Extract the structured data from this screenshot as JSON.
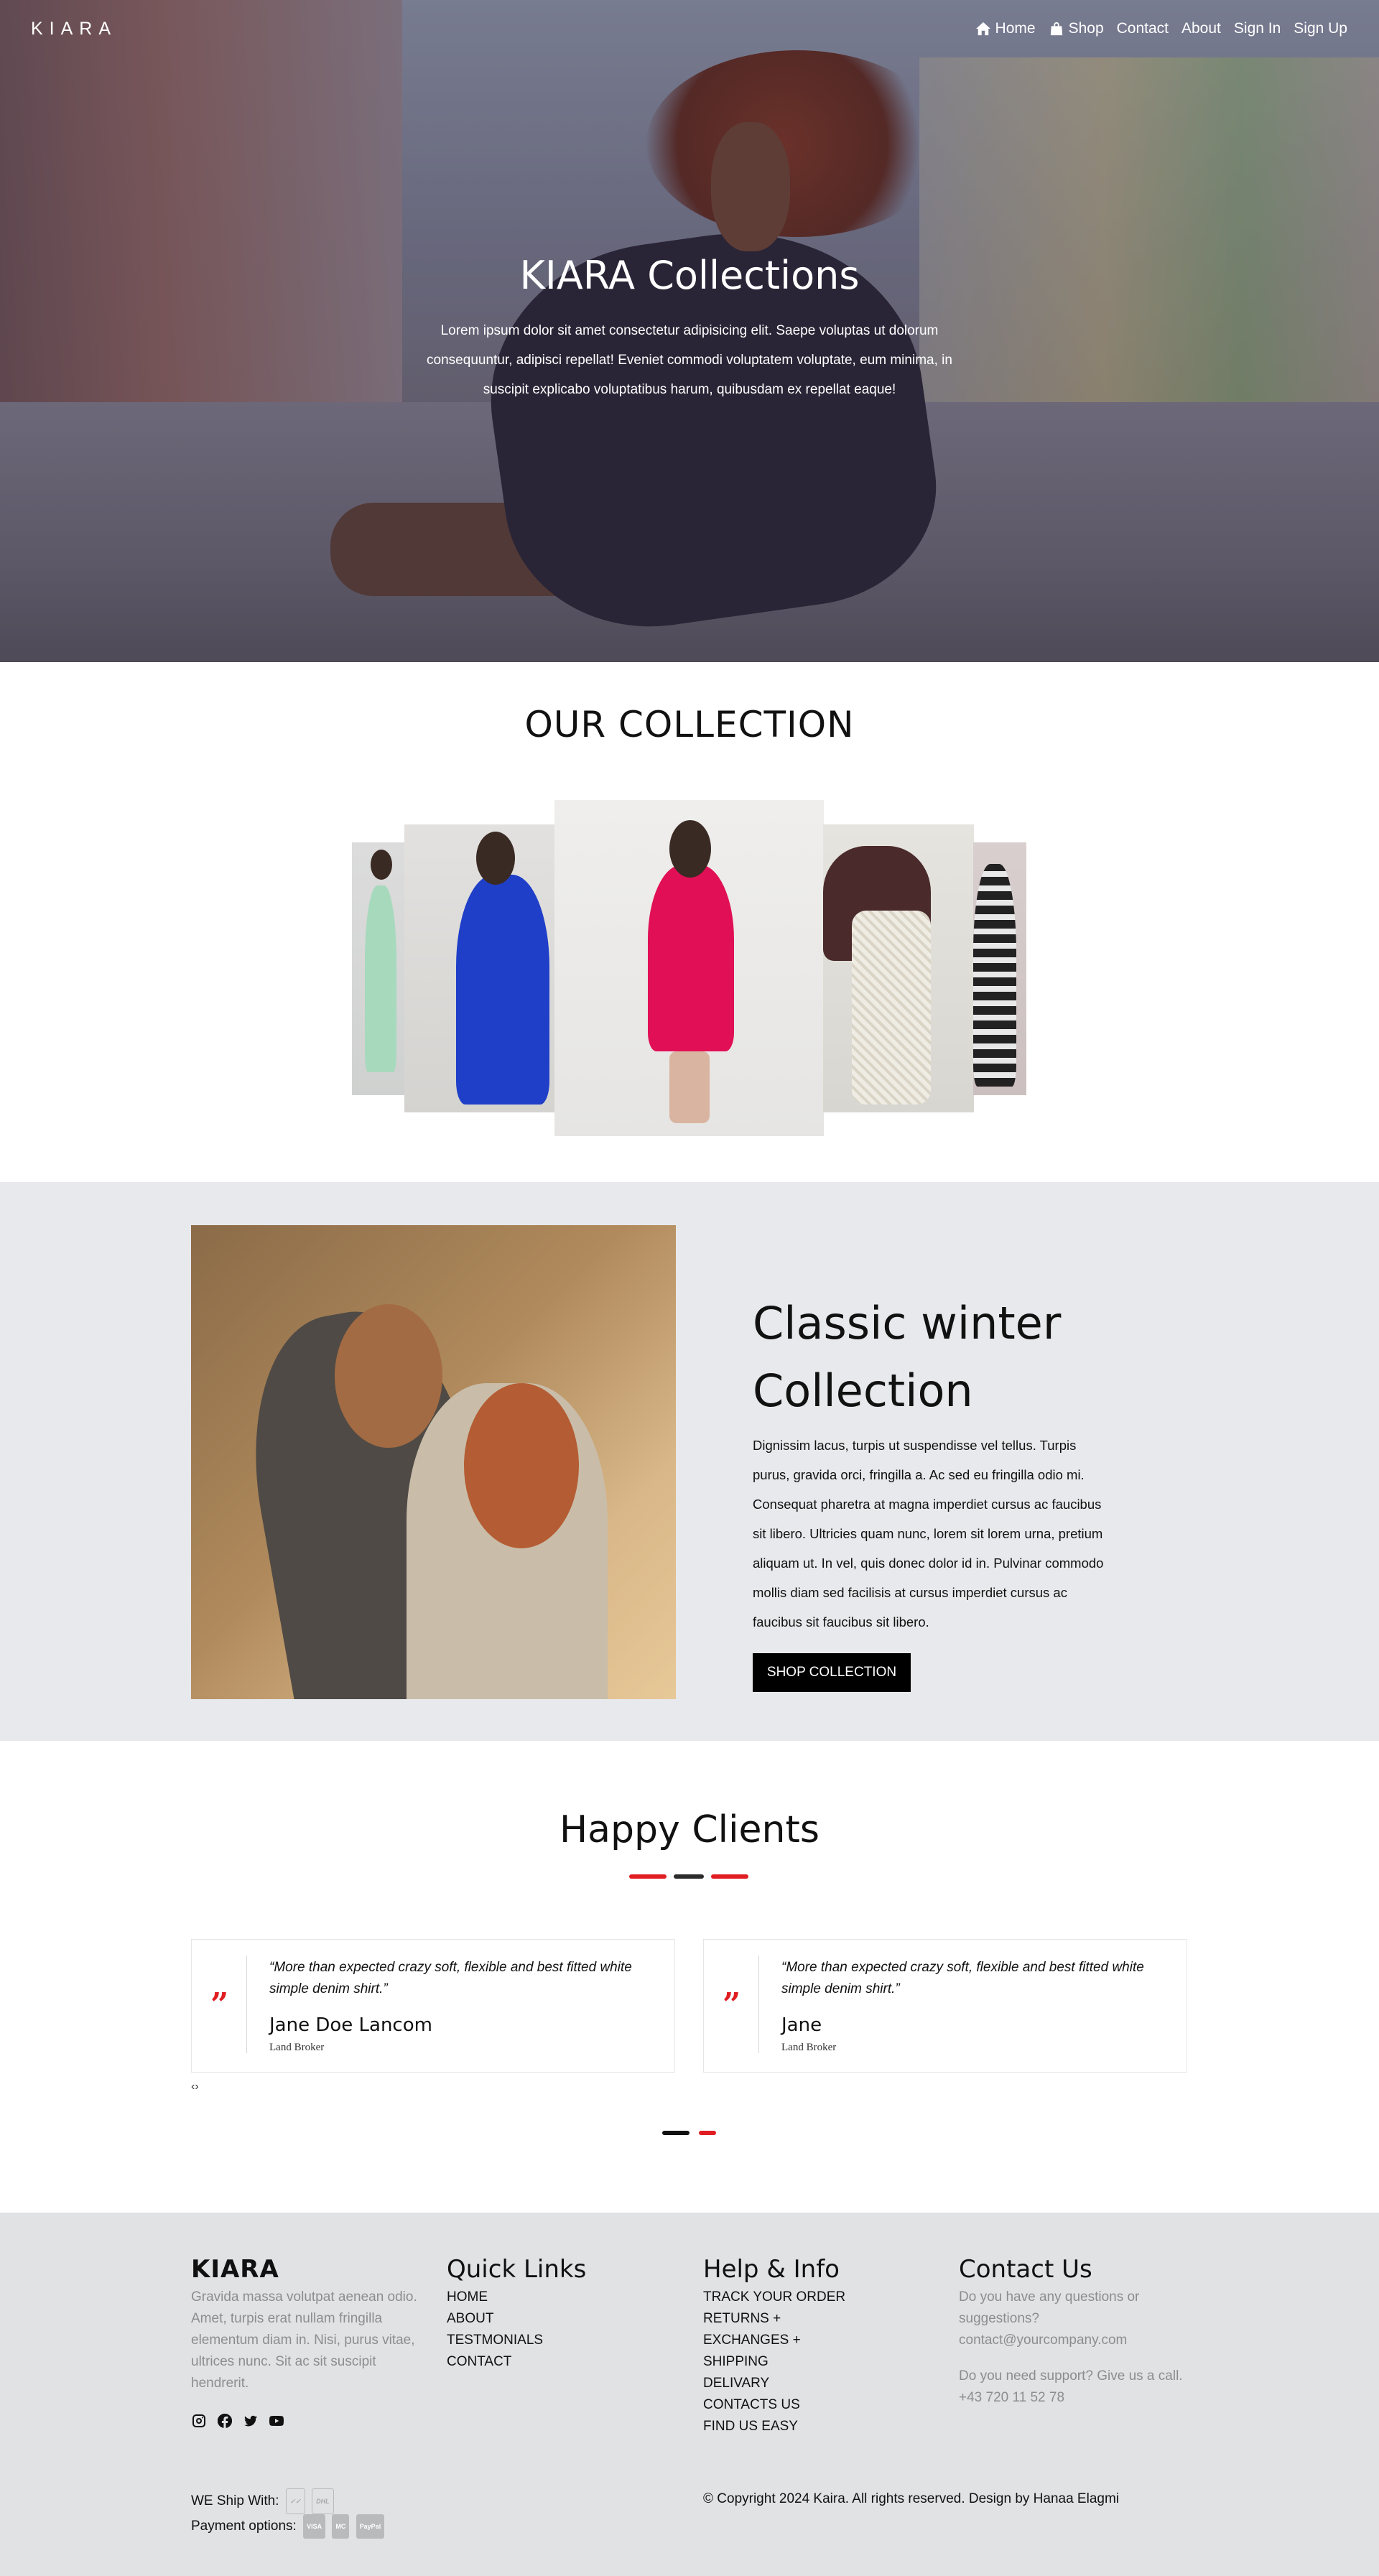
{
  "nav": {
    "logo": "KIARA",
    "links": [
      "Home",
      "Shop",
      "Contact",
      "About",
      "Sign In",
      "Sign Up"
    ]
  },
  "hero": {
    "title": "KIARA Collections",
    "text": "Lorem ipsum dolor sit amet consectetur adipisicing elit. Saepe voluptas ut dolorum consequuntur, adipisci repellat! Eveniet commodi voluptatem voluptate, eum minima, in suscipit explicabo voluptatibus harum, quibusdam ex repellat eaque!"
  },
  "collection": {
    "title": "OUR COLLECTION",
    "cards": [
      {
        "dress_color": "#a7d9bd"
      },
      {
        "dress_color": "#1f3fc8"
      },
      {
        "dress_color": "#e10f55"
      },
      {
        "dress_color": "#4a2a2a"
      },
      {
        "dress_color": "#2b2b2b"
      }
    ]
  },
  "winter": {
    "title": "Classic winter Collection",
    "text": "Dignissim lacus, turpis ut suspendisse vel tellus. Turpis purus, gravida orci, fringilla a. Ac sed eu fringilla odio mi. Consequat pharetra at magna imperdiet cursus ac faucibus sit libero. Ultricies quam nunc, lorem sit lorem urna, pretium aliquam ut. In vel, quis donec dolor id in. Pulvinar commodo mollis diam sed facilisis at cursus imperdiet cursus ac faucibus sit faucibus sit libero.",
    "button": "SHOP COLLECTION"
  },
  "clients": {
    "title": "Happy Clients",
    "testimonials": [
      {
        "quote": "“More than expected crazy soft, flexible and best fitted white simple denim shirt.”",
        "name": "Jane Doe Lancom",
        "role": "Land Broker"
      },
      {
        "quote": "“More than expected crazy soft, flexible and best fitted white simple denim shirt.”",
        "name": "Jane",
        "role": "Land Broker"
      }
    ],
    "arrows": "‹›"
  },
  "footer": {
    "brand": "KIARA",
    "about": "Gravida massa volutpat aenean odio. Amet, turpis erat nullam fringilla elementum diam in. Nisi, purus vitae, ultrices nunc. Sit ac sit suscipit hendrerit.",
    "quick_links": {
      "heading": "Quick Links",
      "items": [
        "HOME",
        "ABOUT",
        "TESTMONIALS",
        "CONTACT"
      ]
    },
    "help": {
      "heading": "Help & Info",
      "items": [
        "TRACK YOUR ORDER",
        "RETURNS +",
        "EXCHANGES +",
        "SHIPPING",
        "DELIVARY",
        "CONTACTS US",
        "FIND US EASY"
      ]
    },
    "contact": {
      "heading": "Contact Us",
      "line1": "Do you have any questions or suggestions?",
      "email": "contact@yourcompany.com",
      "line2": "Do you need support? Give us a call.",
      "phone": "+43 720 11 52 78"
    },
    "ship_label": "WE Ship With:",
    "ship_carriers": [
      "DHL"
    ],
    "payment_label": "Payment options:",
    "payment_methods": [
      "VISA",
      "MC",
      "PayPal"
    ],
    "copyright": "© Copyright 2024 Kaira. All rights reserved. Design by Hanaa Elagmi"
  },
  "colors": {
    "accent": "#e01e22",
    "dark": "#111111",
    "winter_bg": "#e8e9ec",
    "footer_bg": "#e1e2e4"
  }
}
